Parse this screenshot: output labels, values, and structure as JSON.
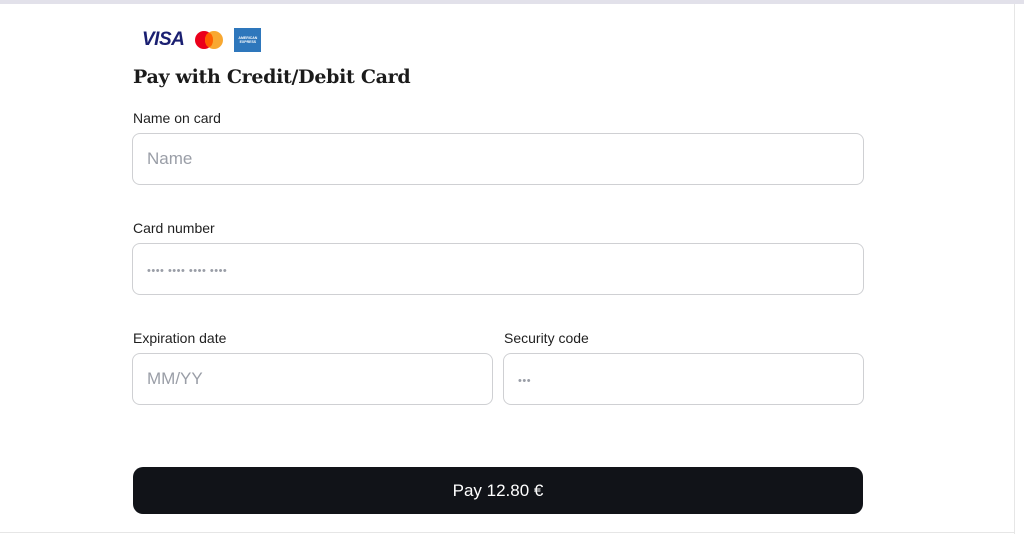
{
  "card_logos": {
    "visa": "VISA",
    "mastercard_icon": "mastercard-logo",
    "amex_lines": [
      "AMERICAN",
      "EXPRESS"
    ]
  },
  "title": "Pay with Credit/Debit Card",
  "fields": {
    "name": {
      "label": "Name on card",
      "placeholder": "Name",
      "value": ""
    },
    "card_number": {
      "label": "Card number",
      "placeholder": "•••• •••• •••• ••••",
      "value": ""
    },
    "expiration": {
      "label": "Expiration date",
      "placeholder": "MM/YY",
      "value": ""
    },
    "security_code": {
      "label": "Security code",
      "placeholder": "•••",
      "value": ""
    }
  },
  "pay_button": {
    "label": "Pay 12.80 €"
  },
  "colors": {
    "button_bg": "#111318",
    "button_text": "#ffffff",
    "input_border": "#cfd0d3",
    "placeholder": "#9a9ea7",
    "visa_blue": "#1a1f71",
    "amex_blue": "#2e77bc"
  }
}
